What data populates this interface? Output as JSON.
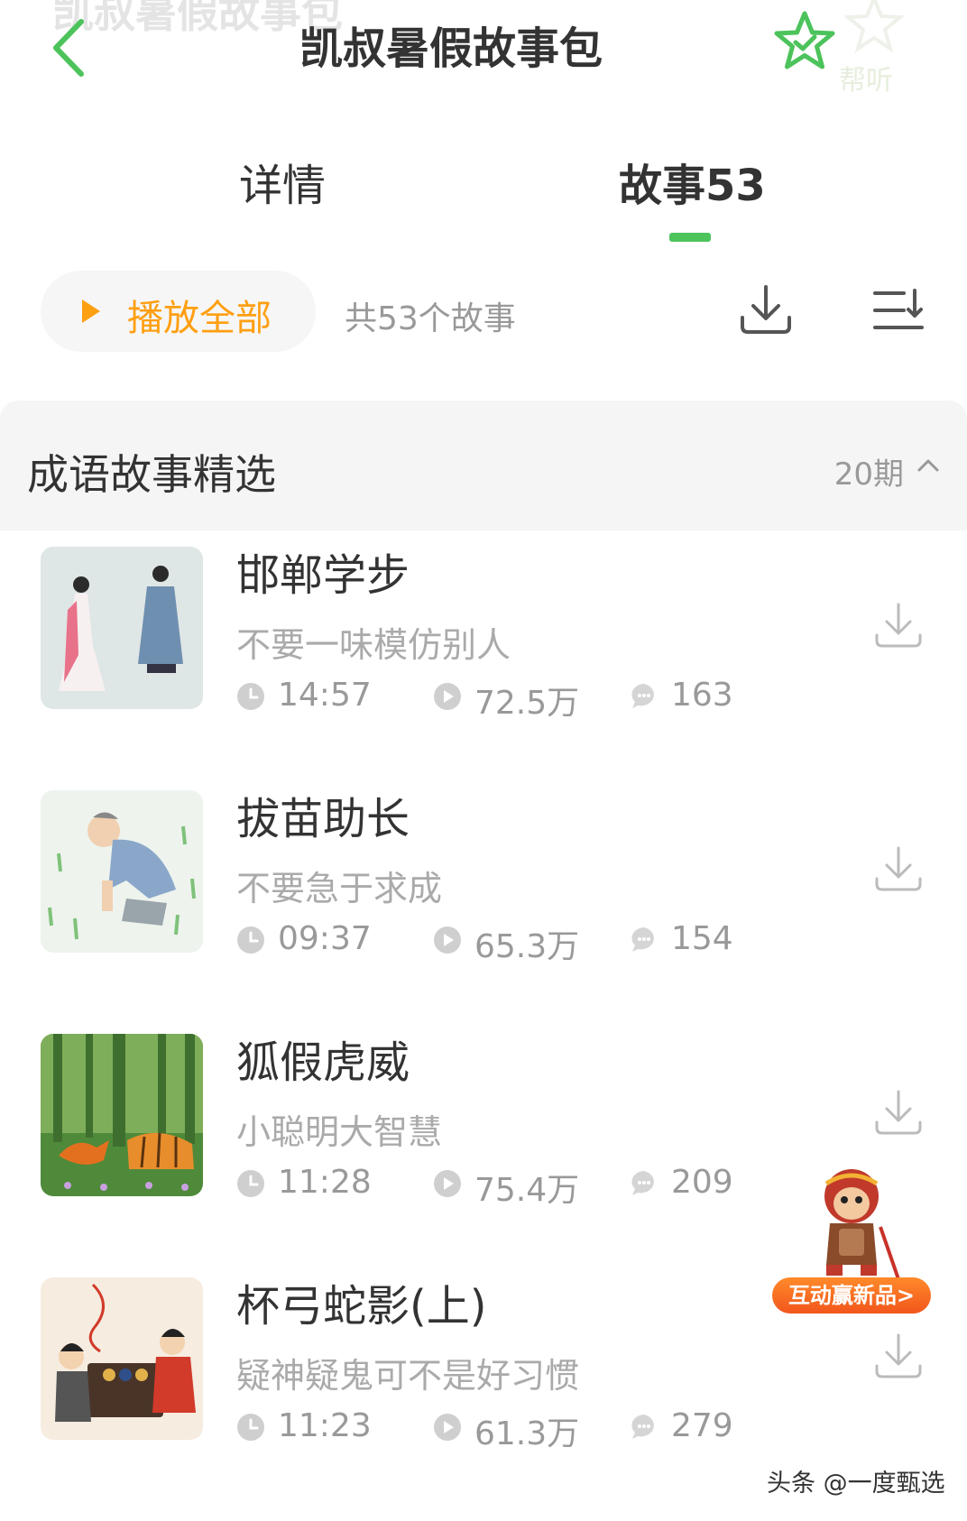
{
  "header": {
    "back_icon": "chevron-left-icon",
    "title": "凯叔暑假故事包",
    "faded_title": "凯叔暑假故事包",
    "faded_help": "帮听",
    "star_icon": "star-check-icon",
    "accent_color": "#4cc35b"
  },
  "tabs": [
    {
      "label": "详情",
      "active": false
    },
    {
      "label": "故事53",
      "active": true
    }
  ],
  "actions": {
    "play_all_label": "播放全部",
    "play_color": "#ff9f12",
    "total_label": "共53个故事",
    "download_icon": "download-icon",
    "sort_icon": "sort-list-icon"
  },
  "section": {
    "title": "成语故事精选",
    "count": "20期",
    "chevron_icon": "chevron-up-icon"
  },
  "items": [
    {
      "title": "邯郸学步",
      "subtitle": "不要一味模仿别人",
      "duration": "14:57",
      "plays": "72.5万",
      "comments": "163",
      "thumb": "two-figures-in-robes"
    },
    {
      "title": "拔苗助长",
      "subtitle": "不要急于求成",
      "duration": "09:37",
      "plays": "65.3万",
      "comments": "154",
      "thumb": "farmer-pulling-seedlings"
    },
    {
      "title": "狐假虎威",
      "subtitle": "小聪明大智慧",
      "duration": "11:28",
      "plays": "75.4万",
      "comments": "209",
      "thumb": "fox-and-tiger-in-forest"
    },
    {
      "title": "杯弓蛇影(上)",
      "subtitle": "疑神疑鬼可不是好习惯",
      "duration": "11:23",
      "plays": "61.3万",
      "comments": "279",
      "thumb": "two-children-at-table"
    }
  ],
  "promo": {
    "label": "互动赢新品>",
    "icon": "monkey-king-mascot-icon"
  },
  "watermark": "头条 @一度甄选"
}
